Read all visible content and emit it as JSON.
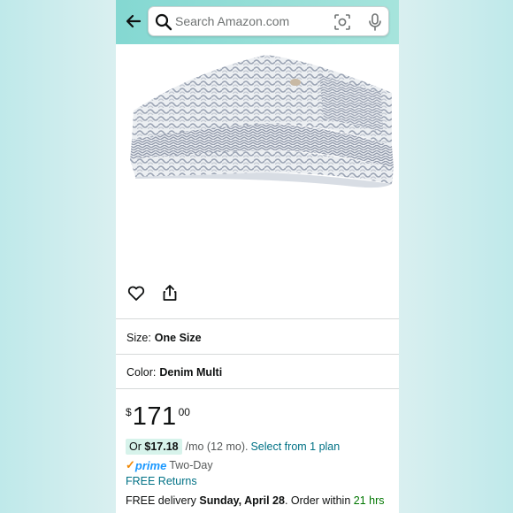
{
  "search": {
    "placeholder": "Search Amazon.com"
  },
  "icons": {
    "back": "back-arrow-icon",
    "search": "search-icon",
    "camera": "camera-lens-icon",
    "mic": "microphone-icon",
    "wishlist": "heart-icon",
    "share": "share-icon"
  },
  "product": {
    "image_alt": "knit throw blanket"
  },
  "size": {
    "label": "Size:",
    "value": "One Size"
  },
  "color": {
    "label": "Color:",
    "value": "Denim Multi"
  },
  "price": {
    "currency": "$",
    "whole": "171",
    "fraction": "00"
  },
  "installment": {
    "prefix": "Or",
    "amount": "$17.18",
    "terms": "/mo (12 mo).",
    "plan_link": "Select from 1 plan"
  },
  "prime": {
    "check": "✓",
    "word": "prime",
    "speed": "Two-Day"
  },
  "returns": {
    "label": "FREE Returns"
  },
  "delivery": {
    "prefix": "FREE delivery",
    "date": "Sunday, April 28",
    "middle": ". Order within",
    "countdown": "21 hrs"
  },
  "colors": {
    "header": "#84d8d2",
    "link": "#007185",
    "prime_blue": "#1a98ff",
    "prime_check": "#f08804",
    "countdown_green": "#007600",
    "installment_badge": "#d7f3eb"
  }
}
